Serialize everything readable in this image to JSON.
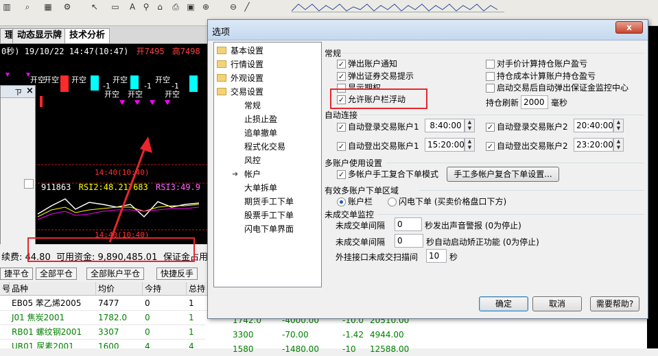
{
  "toolbar": {
    "icons": [
      "bar-chart-icon",
      "search-icon",
      "grid-icon",
      "settings-icon",
      "cursor-icon",
      "new-document-icon",
      "font-icon",
      "binoculars-icon",
      "home-icon",
      "print-icon",
      "save-icon",
      "zoom-in-icon",
      "zoom-out-icon",
      "line-tool-icon"
    ]
  },
  "tabs": [
    {
      "label": "理"
    },
    {
      "label": "动态显示牌"
    },
    {
      "label": "技术分析"
    }
  ],
  "chart": {
    "header": "0秒) 19/10/22 14:47(10:47)",
    "open_label": "开7495",
    "high_label": "高7498",
    "signals_top": [
      "开空",
      "开空",
      "开空",
      "开空",
      "开空"
    ],
    "signals_mid": [
      "开空",
      "开空",
      "开空"
    ],
    "labels_minus": [
      "-1",
      "-1",
      "-1"
    ],
    "time_label_1": "14:40(10:40)",
    "time_label_2": "14:40(10:40)",
    "rsi_line": "911863",
    "rsi2": "RSI2:48.21",
    "rsi2_cont": "7683",
    "rsi3": "RSI3:49.9"
  },
  "mini_window": {
    "title": "ㄗ",
    "close": "×"
  },
  "info": {
    "fee_label": "续费: 44.80",
    "available_label": "可用资金: 9,890,485.01",
    "margin_label": "保证金占用"
  },
  "buttons": [
    "捷平仓",
    "全部平仓",
    "全部账户平仓",
    "快捷反手"
  ],
  "table": {
    "headers": [
      "号",
      "品种",
      "均价",
      "今持",
      "总持"
    ],
    "rows": [
      {
        "name": "EB05 苯乙烯2005",
        "avg": "7477",
        "today": "0",
        "total": "1",
        "color": "#000000"
      },
      {
        "name": "J01 焦炭2001",
        "avg": "1782.0",
        "today": "0",
        "total": "1",
        "color": "#008000"
      },
      {
        "name": "RB01 螺纹钢2001",
        "avg": "3307",
        "today": "0",
        "total": "1",
        "color": "#008000"
      },
      {
        "name": "UR01 尿素2001",
        "avg": "1600",
        "today": "4",
        "total": "4",
        "color": "#008000"
      }
    ],
    "extra_cells": [
      {
        "a": "1742.0",
        "b": "-4000.00",
        "c": "-10.0",
        "d": "20510.00"
      },
      {
        "a": "3300",
        "b": "-70.00",
        "c": "-1.42",
        "d": "4944.00"
      },
      {
        "a": "1580",
        "b": "-1480.00",
        "c": "-10",
        "d": "12588.00"
      }
    ]
  },
  "dialog": {
    "title": "选项",
    "close": "x",
    "tree": [
      {
        "label": "基本设置",
        "type": "folder"
      },
      {
        "label": "行情设置",
        "type": "folder"
      },
      {
        "label": "外观设置",
        "type": "folder"
      },
      {
        "label": "交易设置",
        "type": "folder-open"
      },
      {
        "label": "常规",
        "type": "child"
      },
      {
        "label": "止损止盈",
        "type": "child"
      },
      {
        "label": "追单撤单",
        "type": "child"
      },
      {
        "label": "程式化交易",
        "type": "child"
      },
      {
        "label": "风控",
        "type": "child"
      },
      {
        "label": "帐户",
        "type": "child-selected"
      },
      {
        "label": "大单拆单",
        "type": "child"
      },
      {
        "label": "期货手工下单",
        "type": "child"
      },
      {
        "label": "股票手工下单",
        "type": "child"
      },
      {
        "label": "闪电下单界面",
        "type": "child"
      }
    ],
    "general": {
      "section": "常规",
      "left": [
        {
          "label": "弹出账户通知",
          "checked": true
        },
        {
          "label": "弹出证券交易提示",
          "checked": true
        },
        {
          "label": "显示期权",
          "checked": false
        },
        {
          "label": "允许账户栏浮动",
          "checked": true
        }
      ],
      "right": [
        {
          "label": "对手价计算持仓账户盈亏",
          "checked": false
        },
        {
          "label": "持仓成本计算账户持仓盈亏",
          "checked": false
        },
        {
          "label": "启动交易后自动弹出保证金监控中心",
          "checked": false
        }
      ],
      "refresh_label": "持仓刷新",
      "refresh_value": "2000",
      "refresh_unit": "毫秒"
    },
    "auto_connect": {
      "section": "自动连接",
      "items": [
        {
          "label": "自动登录交易账户1",
          "time": "8:40:00",
          "checked": true
        },
        {
          "label": "自动登录交易账户2",
          "time": "20:40:00",
          "checked": true
        },
        {
          "label": "自动登出交易账户1",
          "time": "15:20:00",
          "checked": true
        },
        {
          "label": "自动登出交易账户2",
          "time": "23:20:00",
          "checked": true
        }
      ]
    },
    "multi_account": {
      "section": "多账户使用设置",
      "mode_label": "多帐户手工复合下单模式",
      "mode_checked": true,
      "settings_button": "手工多帐户复合下单设置..."
    },
    "order_area": {
      "section": "有效多账户下单区域",
      "options": [
        {
          "label": "账户栏",
          "selected": true
        },
        {
          "label": "闪电下单 (买卖价格盘口下方)",
          "selected": false
        }
      ]
    },
    "unfilled": {
      "section": "未成交单监控",
      "rows": [
        {
          "prefix": "未成交单间隔",
          "value": "0",
          "suffix": "秒发出声音警报 (0为停止)"
        },
        {
          "prefix": "未成交单间隔",
          "value": "0",
          "suffix": "秒自动启动矫正功能 (0为停止)"
        },
        {
          "prefix": "外挂接口未成交扫描间",
          "value": "10",
          "suffix": "秒"
        }
      ]
    },
    "buttons": {
      "ok": "确定",
      "cancel": "取消",
      "help": "需要帮助?"
    }
  },
  "colors": {
    "annotation_red": "#e8262c",
    "chart_bg": "#000000",
    "signal_magenta": "#ff00ff",
    "signal_cyan": "#00ffff",
    "bar_red": "#ff2a2a",
    "dialog_title_bg": "#c4d8ee"
  }
}
